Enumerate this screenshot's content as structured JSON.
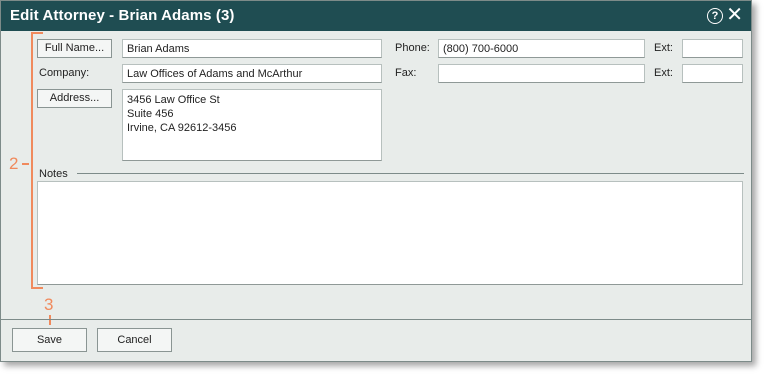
{
  "window": {
    "title": "Edit Attorney - Brian Adams (3)"
  },
  "buttons": {
    "full_name": "Full Name...",
    "address": "Address...",
    "save": "Save",
    "cancel": "Cancel"
  },
  "labels": {
    "company": "Company:",
    "phone": "Phone:",
    "fax": "Fax:",
    "ext": "Ext:",
    "notes": "Notes"
  },
  "fields": {
    "full_name": "Brian Adams",
    "company": "Law Offices of Adams and McArthur",
    "address": "3456 Law Office St\nSuite 456\nIrvine, CA 92612-3456",
    "phone": "(800) 700-6000",
    "phone_ext": "",
    "fax": "",
    "fax_ext": "",
    "notes": ""
  },
  "annotations": {
    "bracket_label": "2",
    "pointer_label": "3"
  },
  "icons": {
    "help": "help-icon",
    "close": "close-icon"
  },
  "colors": {
    "titlebar": "#1f4d52",
    "annotation": "#f08a5d",
    "background": "#e8ecea"
  }
}
